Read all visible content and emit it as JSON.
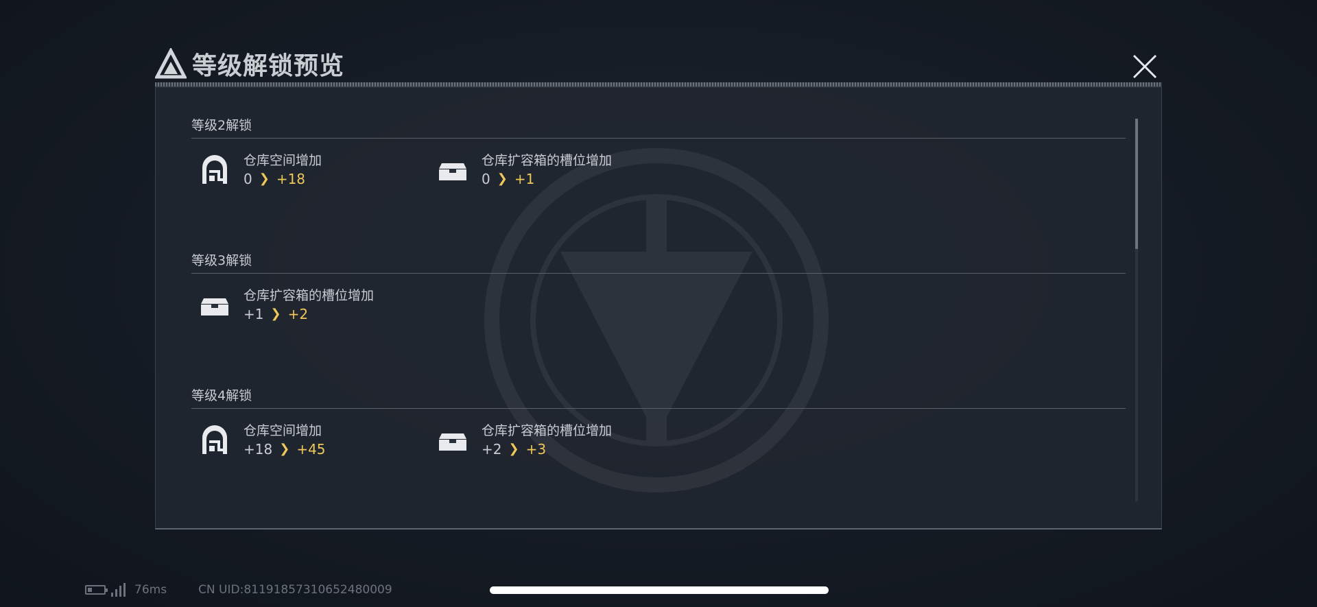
{
  "header": {
    "title": "等级解锁预览"
  },
  "sections": [
    {
      "title": "等级2解锁",
      "items": [
        {
          "icon": "warehouse-icon",
          "label": "仓库空间增加",
          "from": "0",
          "to": "+18"
        },
        {
          "icon": "storage-box-icon",
          "label": "仓库扩容箱的槽位增加",
          "from": "0",
          "to": "+1"
        }
      ]
    },
    {
      "title": "等级3解锁",
      "items": [
        {
          "icon": "storage-box-icon",
          "label": "仓库扩容箱的槽位增加",
          "from": "+1",
          "to": "+2"
        }
      ]
    },
    {
      "title": "等级4解锁",
      "items": [
        {
          "icon": "warehouse-icon",
          "label": "仓库空间增加",
          "from": "+18",
          "to": "+45"
        },
        {
          "icon": "storage-box-icon",
          "label": "仓库扩容箱的槽位增加",
          "from": "+2",
          "to": "+3"
        }
      ]
    }
  ],
  "arrow_glyph": "❯",
  "status": {
    "ping": "76ms",
    "uid": "CN UID:81191857310652480009"
  },
  "colors": {
    "accent": "#f0c85a",
    "panel": "#212730",
    "text": "#c9cdd3"
  }
}
